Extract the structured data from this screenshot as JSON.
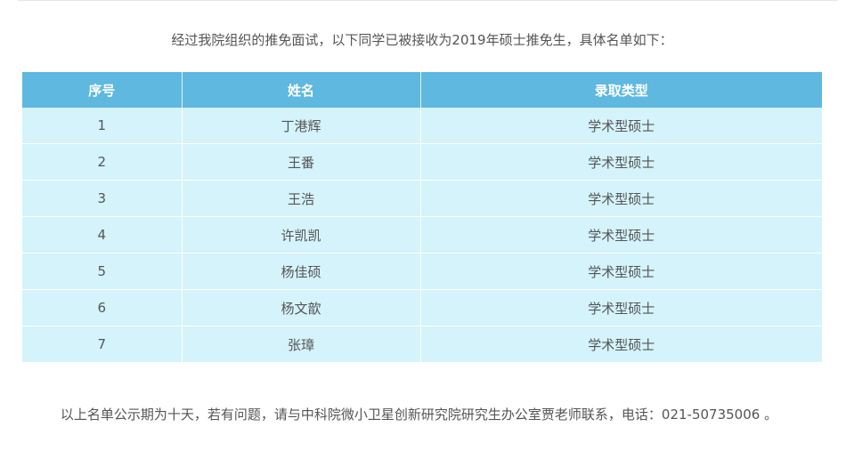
{
  "intro_text": "经过我院组织的推免面试，以下同学已被接收为2019年硕士推免生，具体名单如下：",
  "table": {
    "headers": {
      "seq": "序号",
      "name": "姓名",
      "type": "录取类型"
    },
    "rows": [
      {
        "seq": "1",
        "name": "丁港辉",
        "type": "学术型硕士"
      },
      {
        "seq": "2",
        "name": "王番",
        "type": "学术型硕士"
      },
      {
        "seq": "3",
        "name": "王浩",
        "type": "学术型硕士"
      },
      {
        "seq": "4",
        "name": "许凯凯",
        "type": "学术型硕士"
      },
      {
        "seq": "5",
        "name": "杨佳硕",
        "type": "学术型硕士"
      },
      {
        "seq": "6",
        "name": "杨文歆",
        "type": "学术型硕士"
      },
      {
        "seq": "7",
        "name": "张璋",
        "type": "学术型硕士"
      }
    ]
  },
  "footer_text": "以上名单公示期为十天，若有问题，请与中科院微小卫星创新研究院研究生办公室贾老师联系，电话：021-50735006 。",
  "colors": {
    "header_bg": "#5eb8df",
    "row_bg": "#d4f3fb",
    "text": "#555555"
  }
}
